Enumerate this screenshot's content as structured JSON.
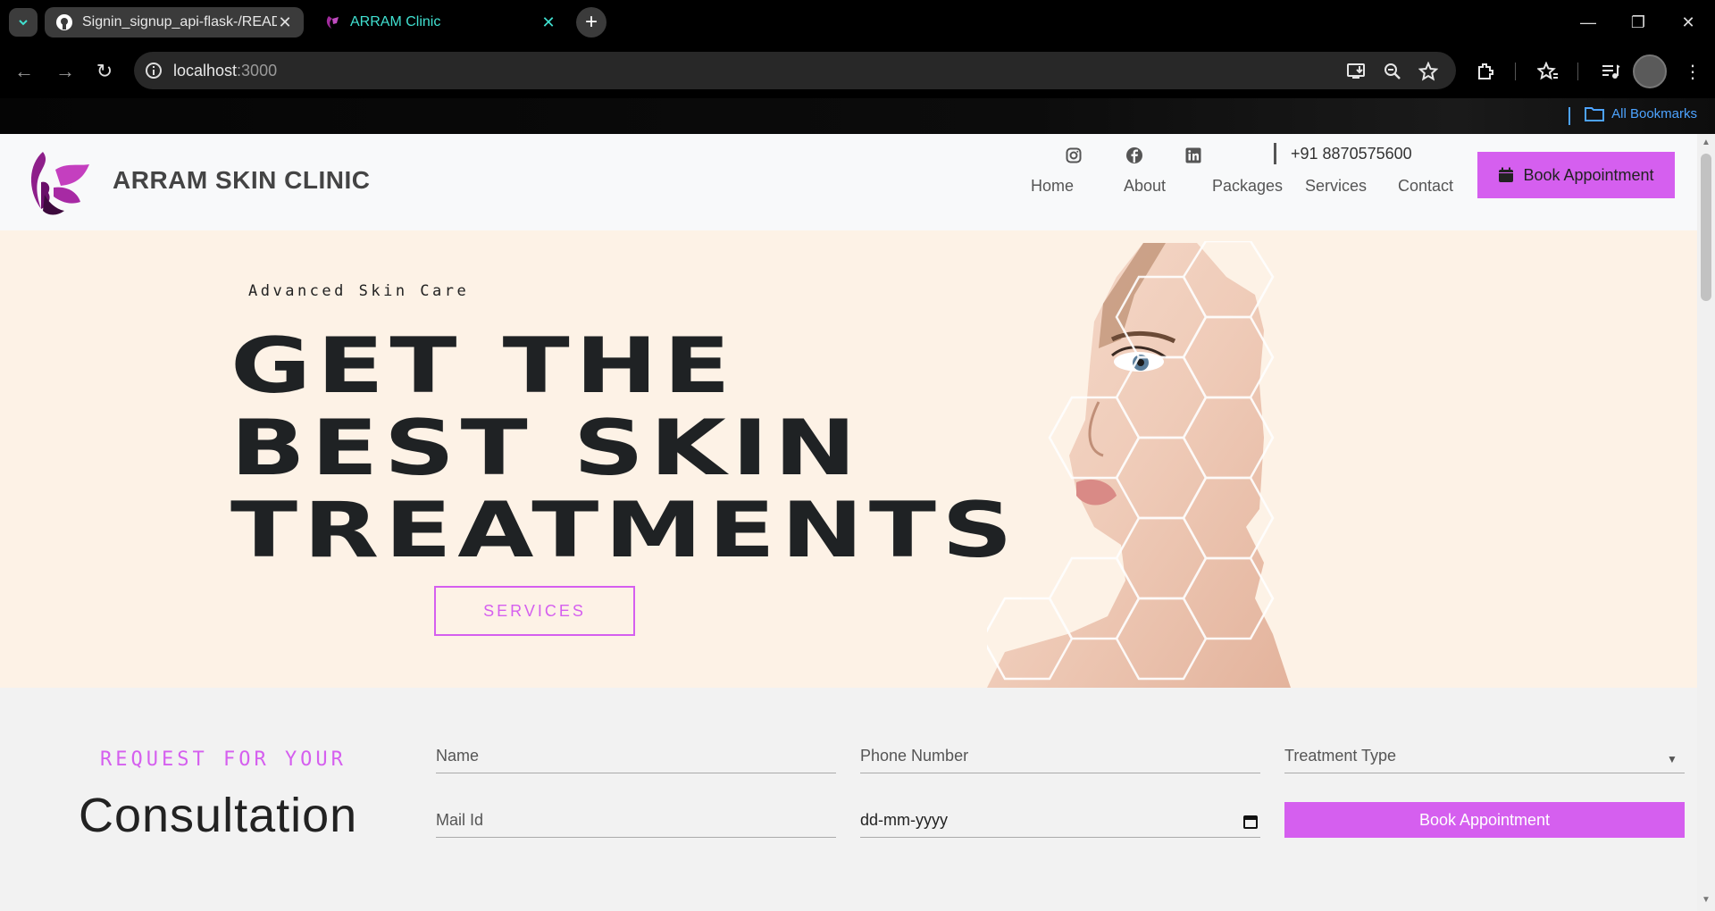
{
  "browser": {
    "tabs": [
      {
        "title": "Signin_signup_api-flask-/READM",
        "active": false
      },
      {
        "title": "ARRAM Clinic",
        "active": true
      }
    ],
    "address": {
      "host": "localhost",
      "port": ":3000"
    },
    "bookmarks_label": "All Bookmarks"
  },
  "header": {
    "brand": "ARRAM SKIN CLINIC",
    "social_icons": [
      "instagram-icon",
      "facebook-icon",
      "linkedin-icon"
    ],
    "phone": "+91 8870575600",
    "nav": [
      "Home",
      "About",
      "Packages",
      "Services",
      "Contact"
    ],
    "cta_label": "Book Appointment"
  },
  "hero": {
    "eyebrow": "Advanced Skin Care",
    "title_lines": [
      "GET THE",
      "BEST SKIN",
      "TREATMENTS"
    ],
    "button_label": "SERVICES"
  },
  "consultation": {
    "label": "REQUEST FOR YOUR",
    "title": "Consultation",
    "fields": {
      "name": "Name",
      "phone": "Phone Number",
      "treatment": "Treatment Type",
      "email": "Mail Id",
      "date": "dd-mm-yyyy"
    },
    "submit_label": "Book Appointment"
  },
  "colors": {
    "accent": "#d55fef",
    "hero_bg": "#fdf2e6",
    "tab_active": "#40e0d0"
  }
}
